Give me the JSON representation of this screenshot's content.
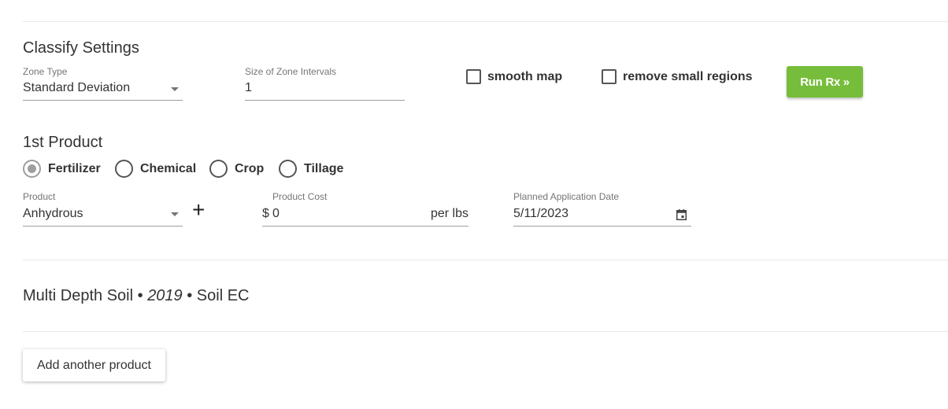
{
  "classify": {
    "title": "Classify Settings",
    "zone_type_label": "Zone Type",
    "zone_type_value": "Standard Deviation",
    "size_label": "Size of Zone Intervals",
    "size_value": "1",
    "smooth_map_label": "smooth map",
    "smooth_map_checked": false,
    "remove_small_label": "remove small regions",
    "remove_small_checked": false,
    "run_button": "Run Rx »",
    "run_button_color": "#76bd3b"
  },
  "product1": {
    "title": "1st Product",
    "types": [
      {
        "label": "Fertilizer",
        "selected": true
      },
      {
        "label": "Chemical",
        "selected": false
      },
      {
        "label": "Crop",
        "selected": false
      },
      {
        "label": "Tillage",
        "selected": false
      }
    ],
    "product_label": "Product",
    "product_value": "Anhydrous",
    "add_icon": "plus-icon",
    "cost_label": "Product Cost",
    "cost_prefix": "$",
    "cost_value": "0",
    "cost_suffix": "per lbs",
    "date_label": "Planned Application Date",
    "date_value": "5/11/2023",
    "date_icon": "calendar-icon"
  },
  "layer": {
    "name_part1": "Multi Depth Soil •",
    "year": "2019",
    "name_part2": "• Soil EC"
  },
  "actions": {
    "add_product": "Add another product"
  }
}
